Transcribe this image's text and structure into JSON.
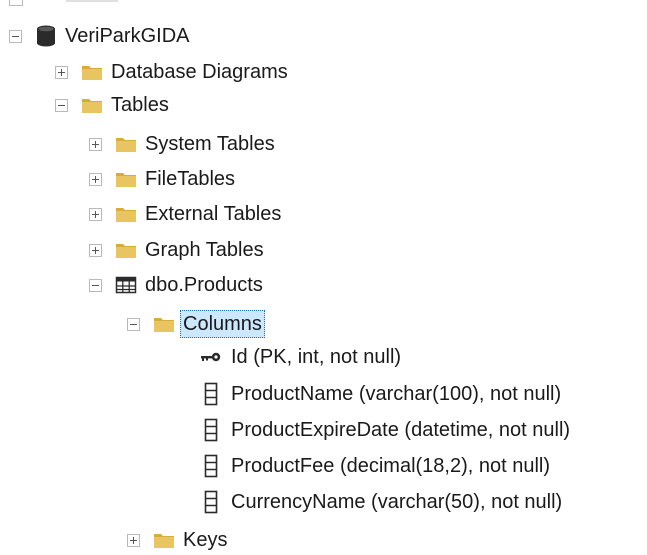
{
  "tree": {
    "database": {
      "label": "VeriParkGIDA",
      "icon": "database-icon"
    },
    "database_diagrams": {
      "label": "Database Diagrams",
      "icon": "folder-icon"
    },
    "tables": {
      "label": "Tables",
      "icon": "folder-icon"
    },
    "system_tables": {
      "label": "System Tables",
      "icon": "folder-icon"
    },
    "file_tables": {
      "label": "FileTables",
      "icon": "folder-icon"
    },
    "external_tables": {
      "label": "External Tables",
      "icon": "folder-icon"
    },
    "graph_tables": {
      "label": "Graph Tables",
      "icon": "folder-icon"
    },
    "products_table": {
      "label": "dbo.Products",
      "icon": "table-grid-icon"
    },
    "columns_folder": {
      "label": "Columns",
      "icon": "folder-icon"
    },
    "columns": [
      {
        "label": "Id (PK, int, not null)",
        "icon": "key-icon"
      },
      {
        "label": "ProductName (varchar(100), not null)",
        "icon": "column-icon"
      },
      {
        "label": "ProductExpireDate (datetime, not null)",
        "icon": "column-icon"
      },
      {
        "label": "ProductFee (decimal(18,2), not null)",
        "icon": "column-icon"
      },
      {
        "label": "CurrencyName (varchar(50), not null)",
        "icon": "column-icon"
      }
    ],
    "keys": {
      "label": "Keys",
      "icon": "folder-icon"
    }
  },
  "colors": {
    "folder": "#e8c561",
    "folder_dark": "#d9ac37",
    "selection_bg": "#cce8ff",
    "selection_border": "#0078d7",
    "toggle_border": "#b9b9b9",
    "icon_dark": "#2b2b2b"
  }
}
